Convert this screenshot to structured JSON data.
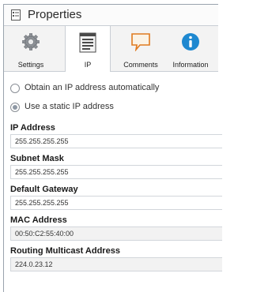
{
  "window": {
    "title": "Properties",
    "title_icon": "properties-icon"
  },
  "tabs": [
    {
      "label": "Settings",
      "icon": "gear-icon",
      "active": false
    },
    {
      "label": "IP",
      "icon": "network-list-icon",
      "active": true
    },
    {
      "label": "Comments",
      "icon": "speech-bubble-icon",
      "active": false
    },
    {
      "label": "Information",
      "icon": "info-icon",
      "active": false
    }
  ],
  "ip_mode": {
    "options": [
      {
        "label": "Obtain an IP address automatically",
        "checked": false
      },
      {
        "label": "Use a static IP address",
        "checked": true
      }
    ]
  },
  "fields": [
    {
      "label": "IP Address",
      "value": "255.255.255.255",
      "readonly": false
    },
    {
      "label": "Subnet Mask",
      "value": "255.255.255.255",
      "readonly": false
    },
    {
      "label": "Default Gateway",
      "value": "255.255.255.255",
      "readonly": false
    },
    {
      "label": "MAC Address",
      "value": "00:50:C2:55:40:00",
      "readonly": true
    },
    {
      "label": "Routing Multicast Address",
      "value": "224.0.23.12",
      "readonly": true
    }
  ],
  "colors": {
    "info_blue": "#1e88d0",
    "bubble_orange": "#e07a1f",
    "tab_bg": "#f3f3f3"
  }
}
